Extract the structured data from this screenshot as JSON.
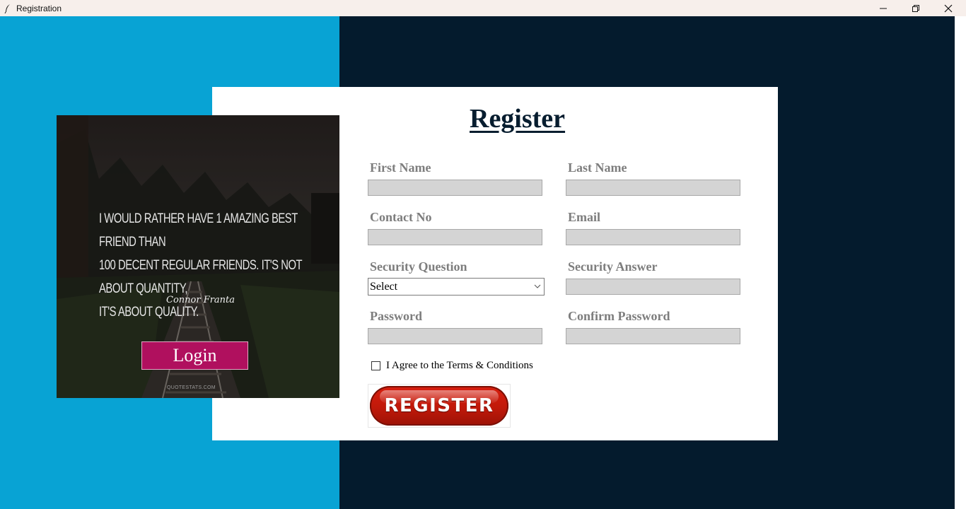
{
  "window": {
    "title": "Registration",
    "controls": {
      "minimize": "minimize-icon",
      "maximize": "restore-icon",
      "close": "close-icon"
    }
  },
  "colors": {
    "left_bg": "#08a3d4",
    "right_bg": "#041b2d",
    "login_button": "#b0105e",
    "register_button": "#c0190a",
    "field_bg": "#d4d4d4",
    "label": "#7d7d7d"
  },
  "quote_panel": {
    "quote_lines": [
      "I would rather have 1 amazing best friend than",
      "100 decent regular friends. It's not about quantity,",
      "it's about quality."
    ],
    "author": "Connor Franta",
    "watermark": "QUOTESTATS.COM",
    "login_label": "Login"
  },
  "form": {
    "title": "Register",
    "first_name": {
      "label": "First Name",
      "value": ""
    },
    "last_name": {
      "label": "Last Name",
      "value": ""
    },
    "contact_no": {
      "label": "Contact No",
      "value": ""
    },
    "email": {
      "label": "Email",
      "value": ""
    },
    "security_question": {
      "label": "Security Question",
      "selected": "Select"
    },
    "security_answer": {
      "label": "Security Answer",
      "value": ""
    },
    "password": {
      "label": "Password",
      "value": ""
    },
    "confirm_password": {
      "label": "Confirm Password",
      "value": ""
    },
    "terms_label": "I Agree to the Terms & Conditions",
    "terms_checked": false,
    "register_label": "REGISTER"
  }
}
